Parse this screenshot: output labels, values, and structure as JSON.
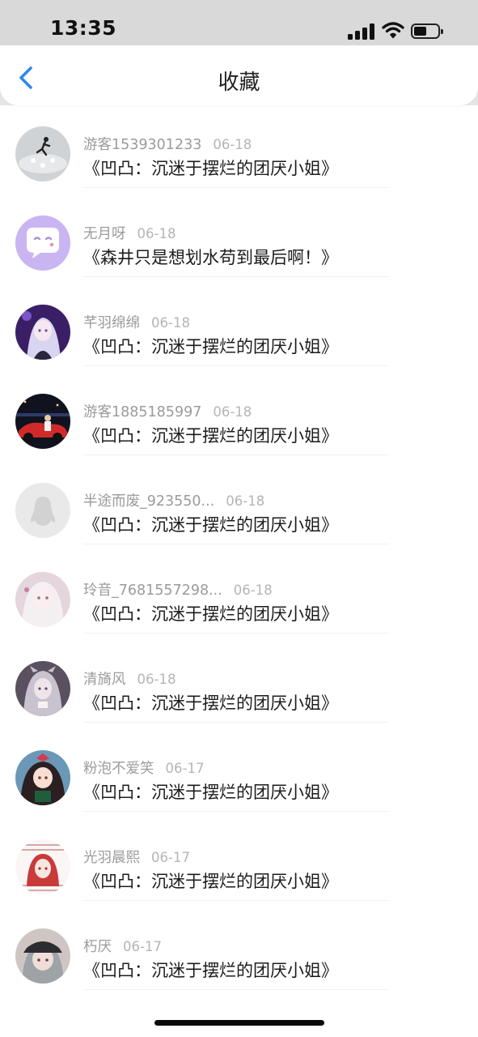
{
  "status": {
    "time": "13:35"
  },
  "nav": {
    "title": "收藏",
    "back_icon": "chevron-left-icon",
    "accent": "#2f86ef"
  },
  "items": [
    {
      "user": "",
      "date": "",
      "title": "《凹凸：沉迷于摆烂的团厌小姐》",
      "avatar": "avatar-yellow"
    },
    {
      "user": "游客1539301233",
      "date": "06-18",
      "title": "《凹凸：沉迷于摆烂的团厌小姐》",
      "avatar": "avatar-runner"
    },
    {
      "user": "无月呀",
      "date": "06-18",
      "title": "《森井只是想划水苟到最后啊！》",
      "avatar": "avatar-chat-bubble"
    },
    {
      "user": "芊羽绵绵",
      "date": "06-18",
      "title": "《凹凸：沉迷于摆烂的团厌小姐》",
      "avatar": "avatar-anime-purple"
    },
    {
      "user": "游客1885185997",
      "date": "06-18",
      "title": "《凹凸：沉迷于摆烂的团厌小姐》",
      "avatar": "avatar-red-car"
    },
    {
      "user": "半途而废_923550...",
      "date": "06-18",
      "title": "《凹凸：沉迷于摆烂的团厌小姐》",
      "avatar": "avatar-default-penguin"
    },
    {
      "user": "玲音_7681557298...",
      "date": "06-18",
      "title": "《凹凸：沉迷于摆烂的团厌小姐》",
      "avatar": "avatar-anime-white"
    },
    {
      "user": "清旖风",
      "date": "06-18",
      "title": "《凹凸：沉迷于摆烂的团厌小姐》",
      "avatar": "avatar-anime-grey"
    },
    {
      "user": "粉泡不爱笑",
      "date": "06-17",
      "title": "《凹凸：沉迷于摆烂的团厌小姐》",
      "avatar": "avatar-anime-dark"
    },
    {
      "user": "光羽晨熙",
      "date": "06-17",
      "title": "《凹凸：沉迷于摆烂的团厌小姐》",
      "avatar": "avatar-anime-red"
    },
    {
      "user": "朽厌",
      "date": "06-17",
      "title": "《凹凸：沉迷于摆烂的团厌小姐》",
      "avatar": "avatar-anime-cap"
    }
  ]
}
